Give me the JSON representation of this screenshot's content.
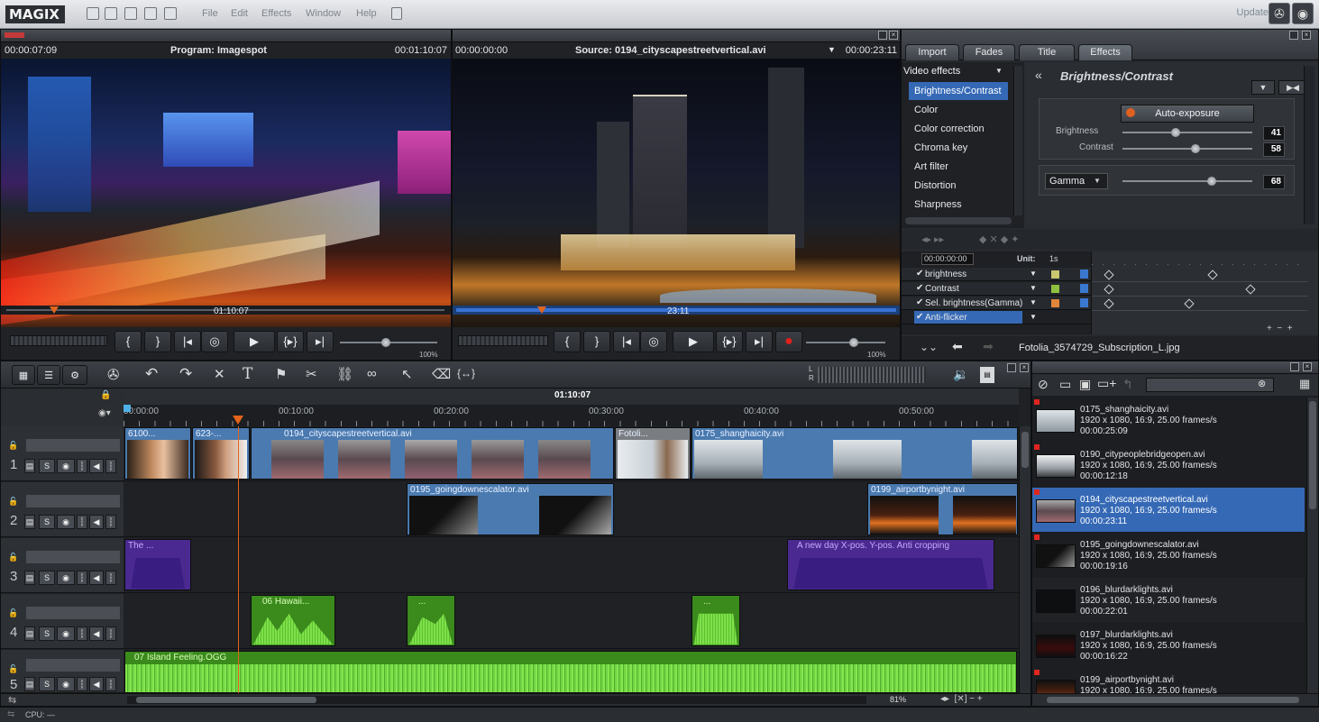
{
  "app": {
    "logo": "MAGIX",
    "menu": [
      "File",
      "Edit",
      "Effects",
      "Window",
      "Help"
    ],
    "update": "Update"
  },
  "program_monitor": {
    "time_left": "00:00:07:09",
    "title": "Program: Imagespot",
    "time_right": "00:01:10:07",
    "scrub_time": "01:10:07",
    "zoom": "100%"
  },
  "source_monitor": {
    "time_left": "00:00:00:00",
    "title": "Source: 0194_cityscapestreetvertical.avi",
    "time_right": "00:00:23:11",
    "scrub_time": "23:11",
    "zoom": "100%"
  },
  "effects": {
    "tabs": [
      "Import",
      "Fades",
      "Title",
      "Effects"
    ],
    "category": "Video effects",
    "list": [
      "Brightness/Contrast",
      "Color",
      "Color correction",
      "Chroma key",
      "Art filter",
      "Distortion",
      "Sharpness"
    ],
    "heading": "Brightness/Contrast",
    "auto_exposure": "Auto-exposure",
    "brightness": {
      "label": "Brightness",
      "value": "41"
    },
    "contrast": {
      "label": "Contrast",
      "value": "58"
    },
    "gamma": {
      "label": "Gamma",
      "value": "68"
    },
    "kf_time": "00:00:00:00",
    "kf_unit_label": "Unit:",
    "kf_unit": "1s",
    "kf_rows": [
      "brightness",
      "Contrast",
      "Sel. brightness(Gamma)",
      "Anti-flicker"
    ],
    "file": "Fotolia_3574729_Subscription_L.jpg"
  },
  "timeline": {
    "position": "01:10:07",
    "ticks": [
      "00:00:00",
      "00:10:00",
      "00:20:00",
      "00:30:00",
      "00:40:00",
      "00:50:00"
    ],
    "track_numbers": [
      "1",
      "2",
      "3",
      "4",
      "5"
    ],
    "solo": "S",
    "zoom": "81%",
    "clips": {
      "c1": "6100...",
      "c2": "623-...",
      "c3": "0194_cityscapestreetvertical.avi",
      "c4": "Fotoli...",
      "c5": "0175_shanghaicity.avi",
      "c6": "0195_goingdownescalator.avi",
      "c7": "0199_airportbynight.avi",
      "t1": "The ...",
      "t2": "A new day  X-pos.  Y-pos.  Anti cropping",
      "a1": "06 Hawaii...",
      "a2": "...",
      "a3": "...",
      "a4": "07 Island Feeling.OGG"
    }
  },
  "media": [
    {
      "name": "0175_shanghaicity.avi",
      "info": "1920 x 1080, 16:9, 25.00 frames/s",
      "dur": "00:00:25:09"
    },
    {
      "name": "0190_citypeoplebridgeopen.avi",
      "info": "1920 x 1080, 16:9, 25.00 frames/s",
      "dur": "00:00:12:18"
    },
    {
      "name": "0194_cityscapestreetvertical.avi",
      "info": "1920 x 1080, 16:9, 25.00 frames/s",
      "dur": "00:00:23:11"
    },
    {
      "name": "0195_goingdownescalator.avi",
      "info": "1920 x 1080, 16:9, 25.00 frames/s",
      "dur": "00:00:19:16"
    },
    {
      "name": "0196_blurdarklights.avi",
      "info": "1920 x 1080, 16:9, 25.00 frames/s",
      "dur": "00:00:22:01"
    },
    {
      "name": "0197_blurdarklights.avi",
      "info": "1920 x 1080, 16:9, 25.00 frames/s",
      "dur": "00:00:16:22"
    },
    {
      "name": "0199_airportbynight.avi",
      "info": "1920 x 1080, 16:9, 25.00 frames/s",
      "dur": ""
    }
  ],
  "status": {
    "cpu": "CPU: —"
  }
}
